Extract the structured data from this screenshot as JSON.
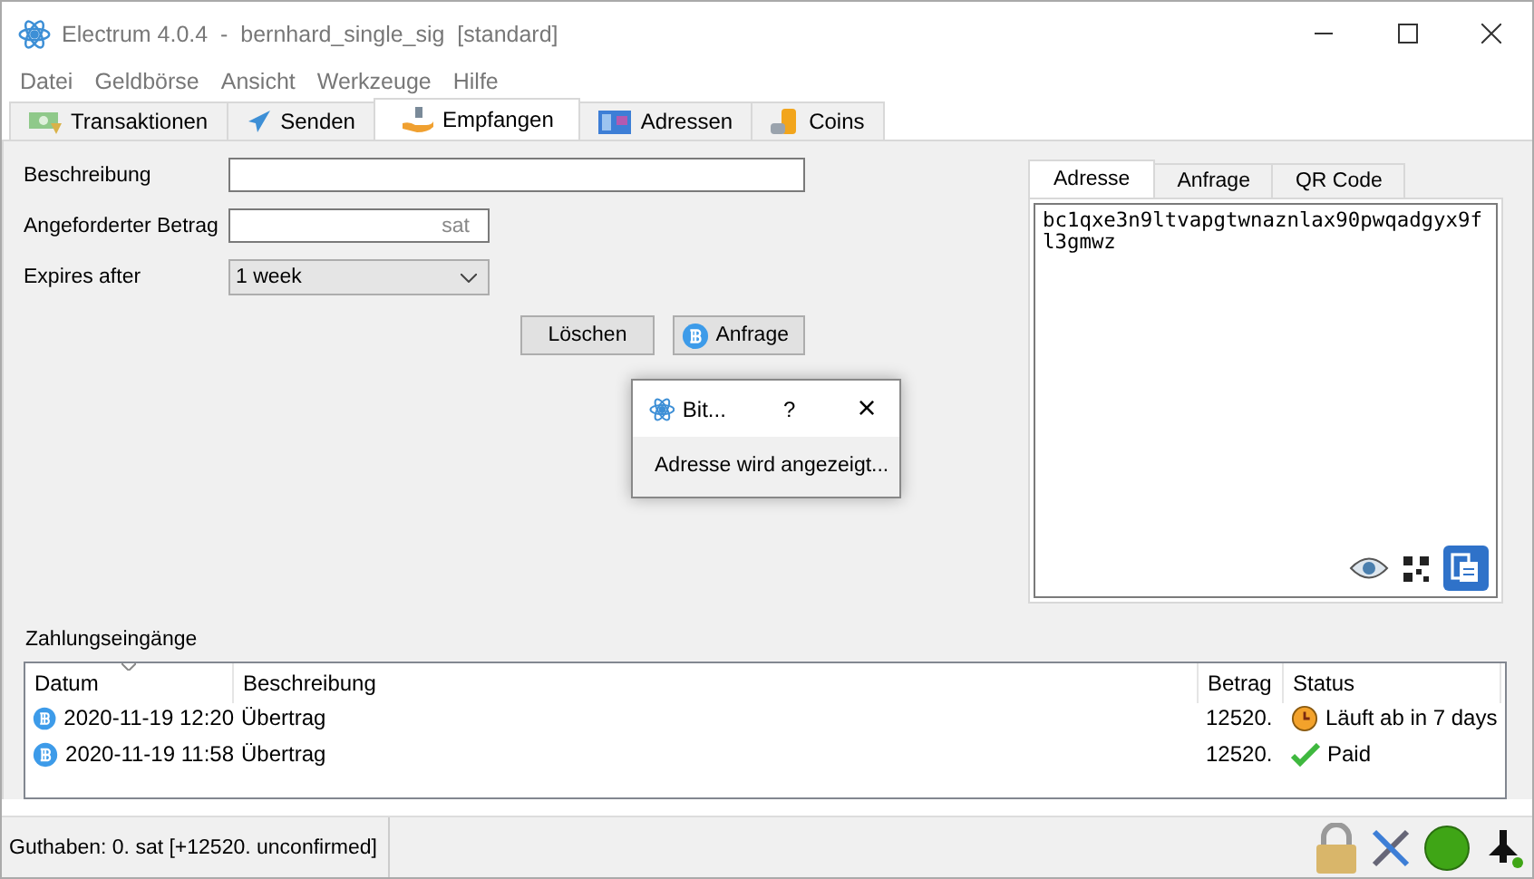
{
  "window": {
    "title": "Electrum 4.0.4  -  bernhard_single_sig  [standard]"
  },
  "menu": [
    "Datei",
    "Geldbörse",
    "Ansicht",
    "Werkzeuge",
    "Hilfe"
  ],
  "tabs": [
    {
      "label": "Transaktionen",
      "selected": false
    },
    {
      "label": "Senden",
      "selected": false
    },
    {
      "label": "Empfangen",
      "selected": true
    },
    {
      "label": "Adressen",
      "selected": false
    },
    {
      "label": "Coins",
      "selected": false
    }
  ],
  "form": {
    "description_label": "Beschreibung",
    "amount_label": "Angeforderter Betrag",
    "amount_unit": "sat",
    "expires_label": "Expires after",
    "expires_value": "1 week",
    "clear_button": "Löschen",
    "request_button": "Anfrage"
  },
  "address_panel": {
    "tabs": [
      {
        "label": "Adresse",
        "selected": true
      },
      {
        "label": "Anfrage",
        "selected": false
      },
      {
        "label": "QR Code",
        "selected": false
      }
    ],
    "address": "bc1qxe3n9ltvapgtwnaznlax90pwqadgyx9fl3gmwz"
  },
  "dialog": {
    "title": "Bit...",
    "help": "?",
    "close": "×",
    "message": "Adresse wird angezeigt..."
  },
  "requests": {
    "title": "Zahlungseingänge",
    "columns": [
      {
        "label": "Datum",
        "sorted": true
      },
      {
        "label": "Beschreibung",
        "sorted": false
      },
      {
        "label": "Betrag",
        "sorted": false
      },
      {
        "label": "Status",
        "sorted": false
      }
    ],
    "rows": [
      {
        "date": "2020-11-19 12:20",
        "description": "Übertrag",
        "amount": "12520.",
        "status": "Läuft ab in 7 days",
        "kind": "expiring"
      },
      {
        "date": "2020-11-19 11:58",
        "description": "Übertrag",
        "amount": "12520.",
        "status": "Paid",
        "kind": "paid"
      }
    ]
  },
  "status_bar": {
    "balance": "Guthaben: 0. sat  [+12520. unconfirmed]",
    "connected": true
  }
}
